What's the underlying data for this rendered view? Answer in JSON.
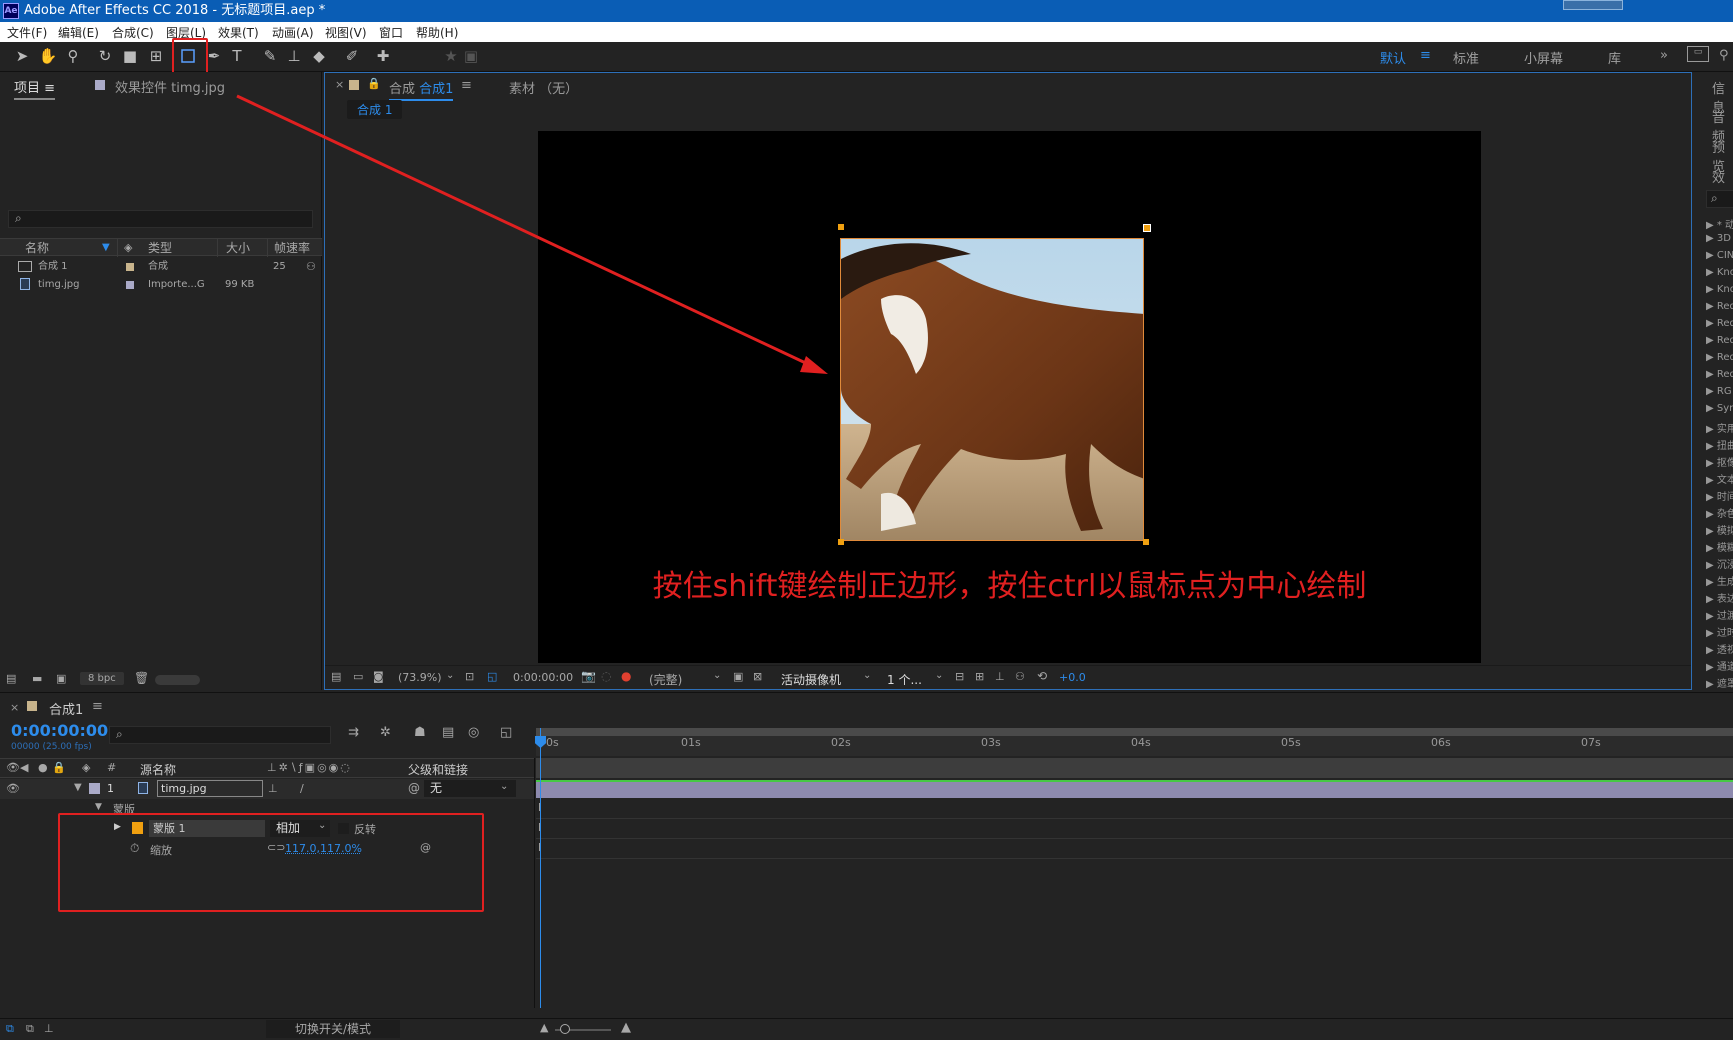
{
  "window": {
    "title": "Adobe After Effects CC 2018 - 无标题项目.aep *",
    "app_icon": "Ae"
  },
  "menu": [
    "文件(F)",
    "编辑(E)",
    "合成(C)",
    "图层(L)",
    "效果(T)",
    "动画(A)",
    "视图(V)",
    "窗口",
    "帮助(H)"
  ],
  "workspaces": {
    "default": "默认",
    "menu_icon": "≡",
    "standard": "标准",
    "small_screen": "小屏幕",
    "library": "库",
    "more": "»"
  },
  "project_panel": {
    "tab_label": "项目",
    "tab_menu": "≡",
    "effects_tab": "效果控件 timg.jpg",
    "search_icon": "⌕",
    "columns": {
      "name": "名称",
      "type": "类型",
      "size": "大小",
      "fps": "帧速率"
    },
    "items": [
      {
        "name": "合成 1",
        "type": "合成",
        "size": "",
        "fps": "25"
      },
      {
        "name": "timg.jpg",
        "type": "Importe...G",
        "size": "99 KB",
        "fps": ""
      }
    ],
    "bpc": "8 bpc"
  },
  "comp_panel": {
    "tab_close": "×",
    "tab_label": "合成",
    "tab_comp": "合成1",
    "tab_menu": "≡",
    "footage_tab": "素材 （无）",
    "subtab": "合成 1",
    "caption": "按住shift键绘制正边形，按住ctrl以鼠标点为中心绘制",
    "zoom": "(73.9%)",
    "timecode": "0:00:00:00",
    "resolution": "(完整)",
    "camera": "活动摄像机",
    "views": "1 个...",
    "exposure": "+0.0"
  },
  "right_panel": {
    "tabs": [
      "信息",
      "音频",
      "预览",
      "效果"
    ],
    "search_icon": "⌕",
    "effects": [
      "* 动",
      "3D",
      "CIN",
      "Kno",
      "Kno",
      "Red",
      "Red",
      "Red",
      "Red",
      "Red",
      "RG",
      "Syn",
      "实用",
      "扭曲",
      "抠像",
      "文本",
      "时间",
      "杂色",
      "模拟",
      "模糊",
      "沉浸",
      "生成",
      "表达",
      "过渡",
      "过时",
      "透视",
      "通道",
      "遮罩"
    ]
  },
  "timeline": {
    "tab_close": "×",
    "tab_label": "合成1",
    "tab_menu": "≡",
    "timecode": "0:00:00:00",
    "frame_info": "00000 (25.00 fps)",
    "search_icon": "⌕",
    "col_hash": "#",
    "col_source": "源名称",
    "col_parent": "父级和链接",
    "layer_index": "1",
    "layer_name": "timg.jpg",
    "parent_value": "无",
    "mask_group": "蒙版",
    "mask_name": "蒙版 1",
    "mask_mode": "相加",
    "invert_label": "反转",
    "scale_label": "缩放",
    "scale_value": "117.0,117.0%",
    "ruler": [
      "0s",
      "01s",
      "02s",
      "03s",
      "04s",
      "05s",
      "06s",
      "07s"
    ],
    "bottom_label": "切换开关/模式"
  },
  "accent_colors": {
    "selection_blue": "#2d8ceb",
    "annotation_red": "#e02020",
    "mask_orange": "#f0a010"
  }
}
